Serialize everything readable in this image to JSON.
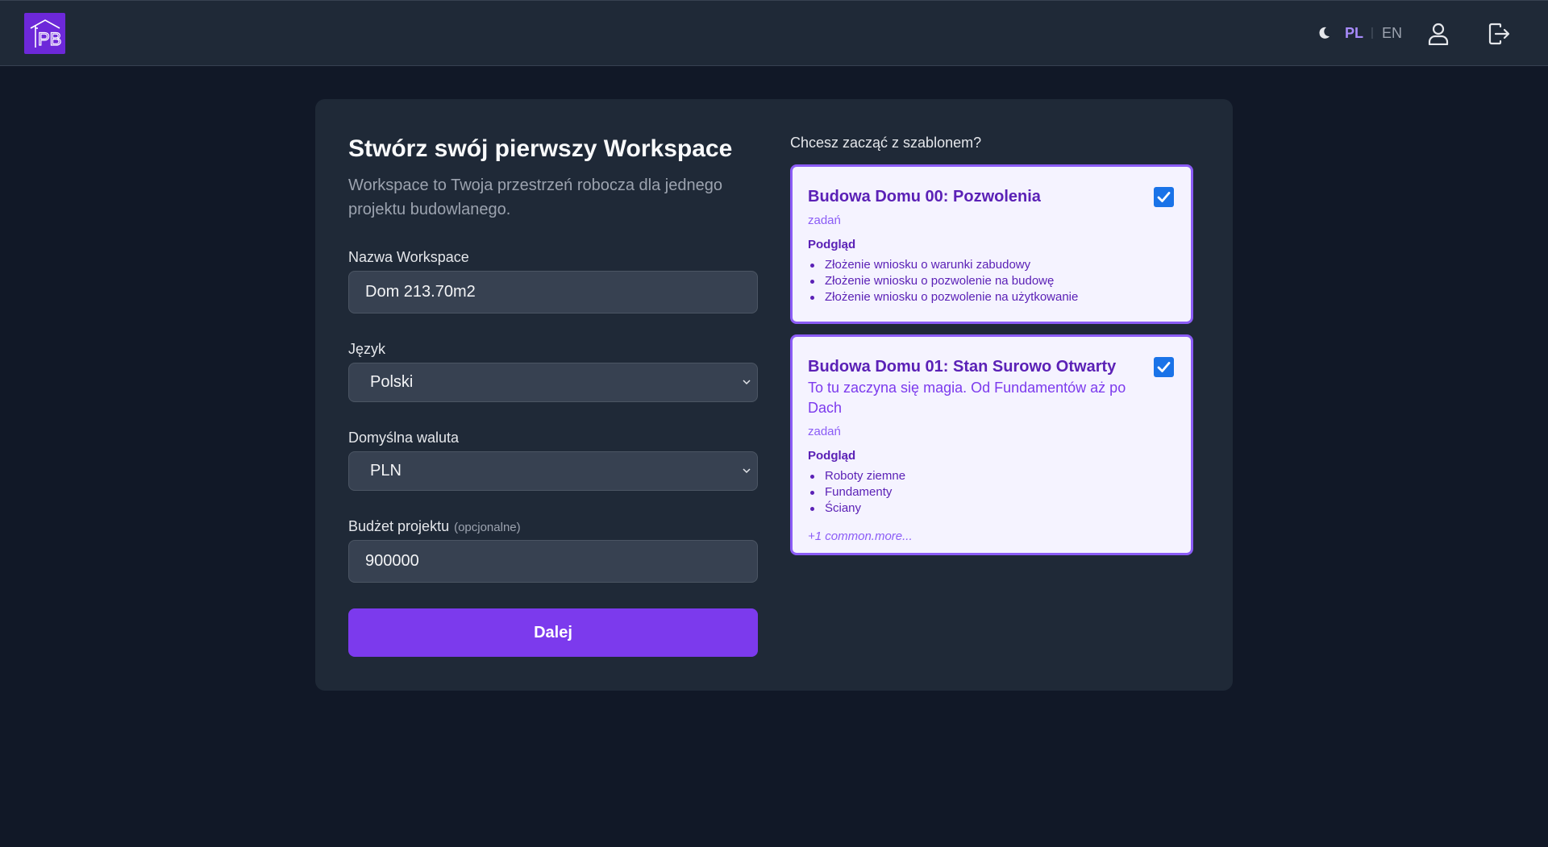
{
  "header": {
    "logo_text": "PB",
    "lang_pl": "PL",
    "lang_separator": "|",
    "lang_en": "EN",
    "icons": {
      "theme": "moon-icon",
      "user": "user-icon",
      "logout": "logout-icon"
    }
  },
  "form": {
    "title": "Stwórz swój pierwszy Workspace",
    "subtitle": "Workspace to Twoja przestrzeń robocza dla jednego projektu budowlanego.",
    "name_label": "Nazwa Workspace",
    "name_value": "Dom 213.70m2",
    "language_label": "Język",
    "language_value": "Polski",
    "currency_label": "Domyślna waluta",
    "currency_value": "PLN",
    "budget_label": "Budżet projektu",
    "budget_optional": "(opcjonalne)",
    "budget_value": "900000",
    "next_label": "Dalej"
  },
  "templates": {
    "heading": "Chcesz zacząć z szablonem?",
    "items": [
      {
        "title": "Budowa Domu 00: Pozwolenia",
        "description": "",
        "count": "zadań",
        "preview_label": "Podgląd",
        "tasks": [
          "Złożenie wniosku o warunki zabudowy",
          "Złożenie wniosku o pozwolenie na budowę",
          "Złożenie wniosku o pozwolenie na użytkowanie"
        ],
        "more": "",
        "checked": true
      },
      {
        "title": "Budowa Domu 01: Stan Surowo Otwarty",
        "description": "To tu zaczyna się magia. Od Fundamentów aż po Dach",
        "count": "zadań",
        "preview_label": "Podgląd",
        "tasks": [
          "Roboty ziemne",
          "Fundamenty",
          "Ściany"
        ],
        "more": "+1 common.more...",
        "checked": true
      }
    ]
  },
  "colors": {
    "background": "#111827",
    "surface": "#1f2937",
    "accent": "#7c3aed",
    "template_bg": "#f5f3ff",
    "checkbox": "#1a73e8"
  }
}
